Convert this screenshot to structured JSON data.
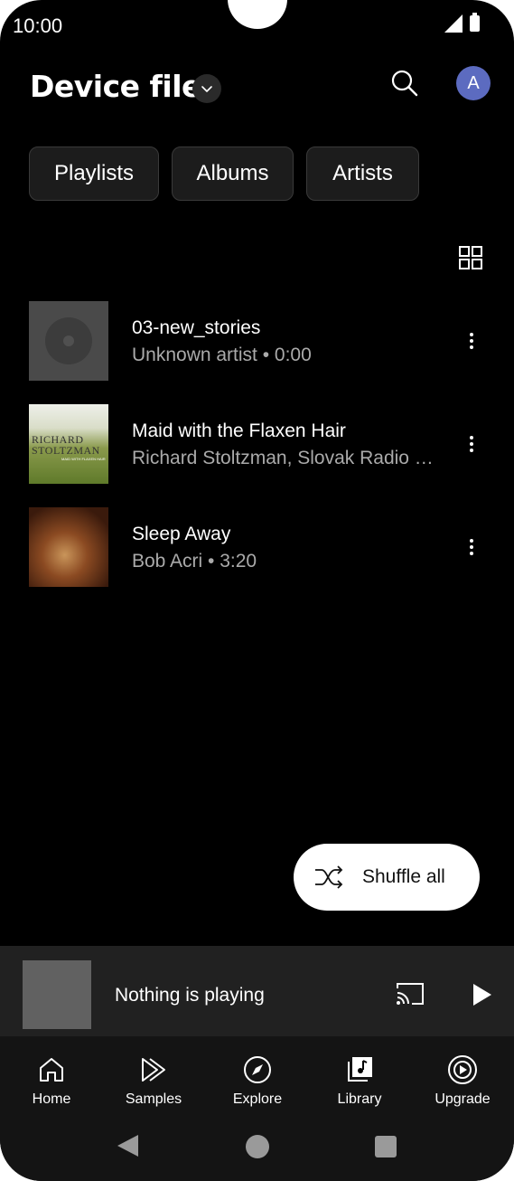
{
  "status_bar": {
    "time": "10:00"
  },
  "header": {
    "title": "Device files"
  },
  "avatar": {
    "initial": "A"
  },
  "chips": [
    {
      "label": "Playlists"
    },
    {
      "label": "Albums"
    },
    {
      "label": "Artists"
    }
  ],
  "tracks": [
    {
      "title": "03-new_stories",
      "subtitle": "Unknown artist • 0:00"
    },
    {
      "title": "Maid with the Flaxen Hair",
      "subtitle": "Richard Stoltzman, Slovak Radio …",
      "art_text_1": "RICHARD",
      "art_text_2": "STOLTZMAN",
      "art_text_3": "MAID WITH FLAXEN HAIR"
    },
    {
      "title": "Sleep Away",
      "subtitle": "Bob Acri • 3:20"
    }
  ],
  "shuffle": {
    "label": "Shuffle all"
  },
  "mini_player": {
    "text": "Nothing is playing"
  },
  "nav": [
    {
      "label": "Home",
      "icon": "home-icon"
    },
    {
      "label": "Samples",
      "icon": "samples-icon"
    },
    {
      "label": "Explore",
      "icon": "compass-icon"
    },
    {
      "label": "Library",
      "icon": "library-icon"
    },
    {
      "label": "Upgrade",
      "icon": "upgrade-icon"
    }
  ],
  "colors": {
    "background": "#000000",
    "avatar": "#5c6bc0",
    "chip_bg": "#1c1c1c",
    "miniplayer_bg": "#212121"
  }
}
